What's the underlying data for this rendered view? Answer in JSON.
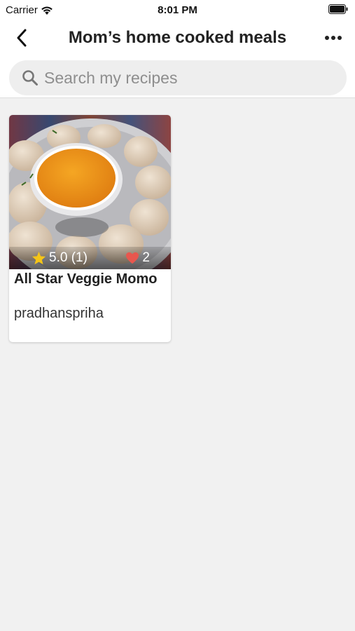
{
  "status_bar": {
    "carrier": "Carrier",
    "time": "8:01 PM"
  },
  "nav": {
    "title": "Mom’s home cooked meals",
    "back_icon": "chevron-left-icon",
    "more_icon": "ellipsis-icon"
  },
  "search": {
    "placeholder": "Search my recipes",
    "value": ""
  },
  "recipes": [
    {
      "title": "All Star Veggie Momo",
      "author": "pradhanspriha",
      "rating": "5.0 (1)",
      "likes": "2",
      "star_color": "#f5c518",
      "heart_color": "#e8574e"
    }
  ]
}
